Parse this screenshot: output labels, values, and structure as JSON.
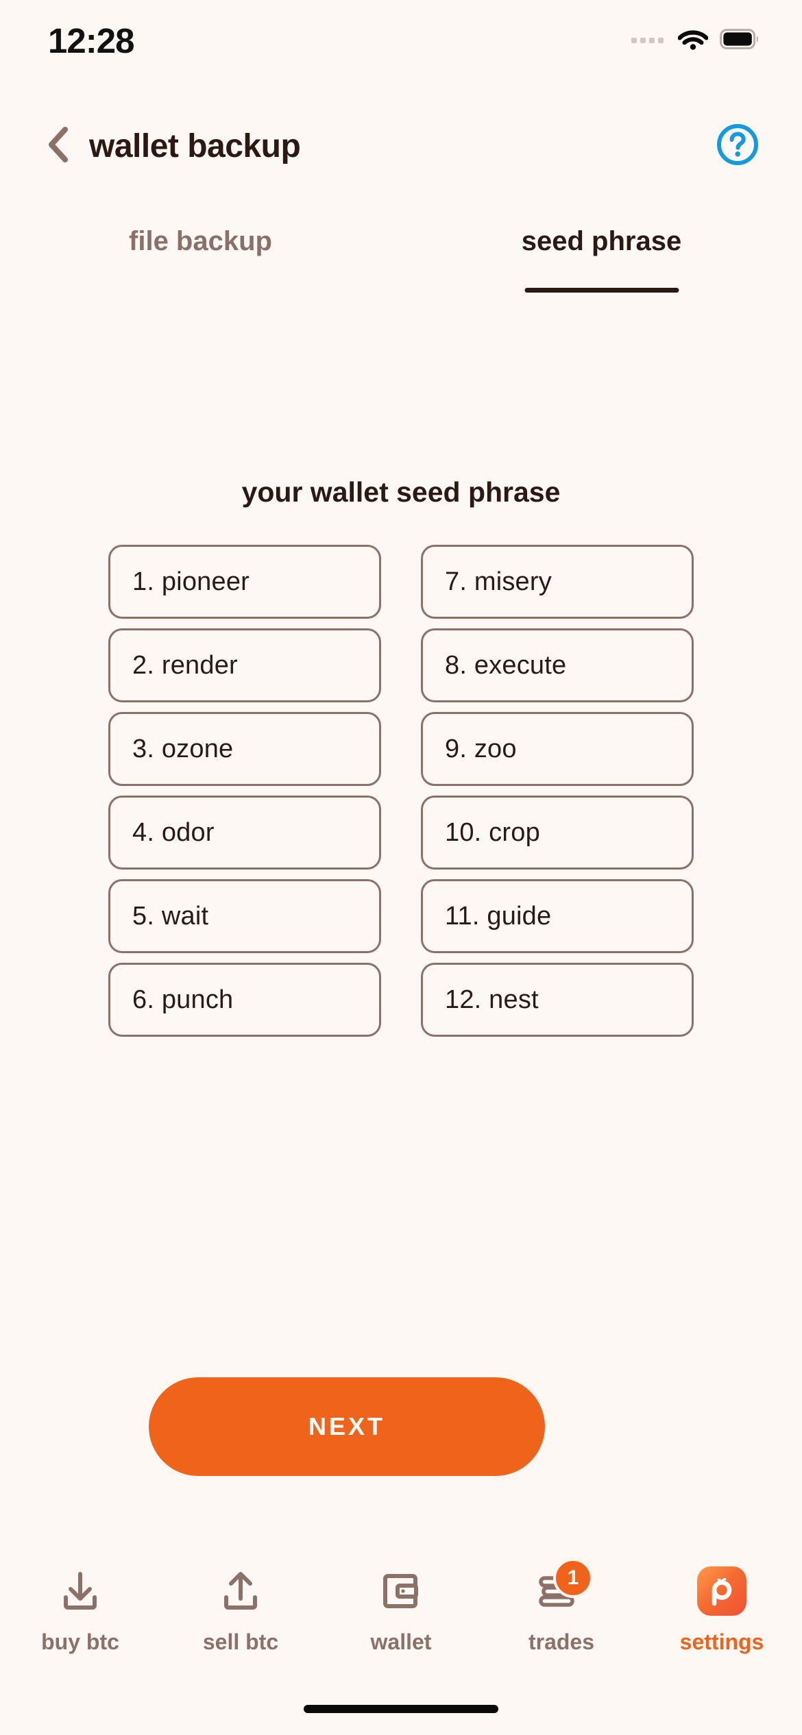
{
  "status_bar": {
    "time": "12:28",
    "signal_icon": "signal-dots-icon",
    "wifi_icon": "wifi-icon",
    "battery_icon": "battery-full-icon"
  },
  "header": {
    "back_icon": "chevron-left-icon",
    "title": "wallet backup",
    "help_icon": "help-circle-icon",
    "help_color": "#139ADF"
  },
  "tabs": [
    {
      "label": "file backup",
      "active": false
    },
    {
      "label": "seed phrase",
      "active": true
    }
  ],
  "main": {
    "heading": "your wallet seed phrase",
    "seed_words": [
      "1. pioneer",
      "2. render",
      "3. ozone",
      "4. odor",
      "5. wait",
      "6. punch",
      "7. misery",
      "8. execute",
      "9. zoo",
      "10. crop",
      "11. guide",
      "12. nest"
    ],
    "next_label": "NEXT",
    "next_color": "#F0631B"
  },
  "bottom_nav": {
    "items": [
      {
        "label": "buy btc",
        "icon": "download-tray-icon",
        "active": false,
        "badge": ""
      },
      {
        "label": "sell btc",
        "icon": "upload-tray-icon",
        "active": false,
        "badge": ""
      },
      {
        "label": "wallet",
        "icon": "wallet-icon",
        "active": false,
        "badge": ""
      },
      {
        "label": "trades",
        "icon": "coins-stack-icon",
        "active": false,
        "badge": "1"
      },
      {
        "label": "settings",
        "icon": "peach-app-logo-icon",
        "active": true,
        "badge": ""
      }
    ],
    "active_color": "#F0631B",
    "inactive_color": "#8B7168"
  },
  "home_indicator": "home-indicator"
}
